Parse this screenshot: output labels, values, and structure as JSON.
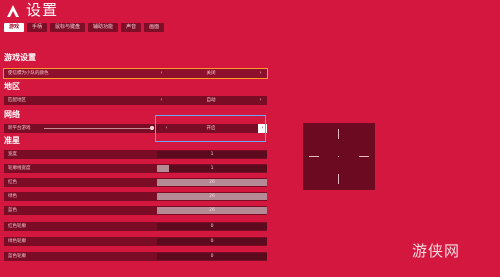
{
  "header": {
    "title": "设置"
  },
  "tabs": [
    {
      "label": "游戏",
      "active": true
    },
    {
      "label": "手柄",
      "active": false
    },
    {
      "label": "鼠标与键盘",
      "active": false
    },
    {
      "label": "辅助功能",
      "active": false
    },
    {
      "label": "声音",
      "active": false
    },
    {
      "label": "画面",
      "active": false
    }
  ],
  "sections": {
    "game": "游戏设置",
    "region": "地区",
    "network": "网络",
    "crosshair": "准星"
  },
  "rows": {
    "teammate_color": {
      "label": "使信標为小队的颜色",
      "value": "关闭"
    },
    "matchmaking": {
      "label": "匹配地区",
      "value": "自动"
    },
    "crossplay": {
      "label": "跨平台游戏",
      "value": "开启"
    },
    "width": {
      "label": "宽度",
      "value": "1"
    },
    "outline_width": {
      "label": "轮廓线宽度",
      "value": "1"
    },
    "red": {
      "label": "红色",
      "value": "26",
      "fraction": 1.0
    },
    "green": {
      "label": "绿色",
      "value": "26",
      "fraction": 1.0
    },
    "blue": {
      "label": "蓝色",
      "value": "26",
      "fraction": 1.0
    },
    "red_outline": {
      "label": "红色轮廓",
      "value": "0"
    },
    "green_outline": {
      "label": "绿色轮廓",
      "value": "0"
    },
    "blue_outline": {
      "label": "蓝色轮廓",
      "value": "0"
    }
  },
  "arrows": {
    "left": "‹",
    "right": "›"
  },
  "watermark": "游侠网",
  "colors": {
    "background": "#d4173f",
    "row": "#7a0c25",
    "focus": "#68a8ff",
    "selected": "#ff9a2b"
  }
}
